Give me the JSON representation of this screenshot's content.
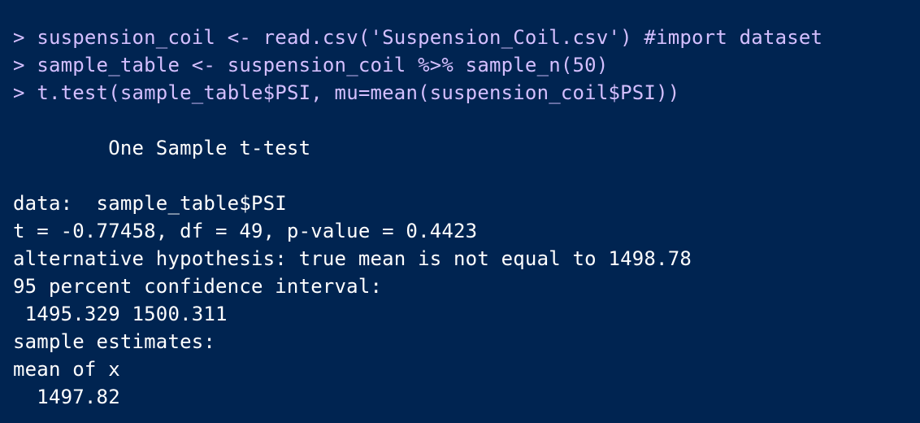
{
  "colors": {
    "background": "#002451",
    "command_text": "#d4bfff",
    "output_text": "#ffffff"
  },
  "console": {
    "prompt": "> ",
    "commands": [
      "suspension_coil <- read.csv('Suspension_Coil.csv') #import dataset",
      "sample_table <- suspension_coil %>% sample_n(50)",
      "t.test(sample_table$PSI, mu=mean(suspension_coil$PSI))"
    ],
    "output": {
      "title": "        One Sample t-test",
      "data_line": "data:  sample_table$PSI",
      "stats_line": "t = -0.77458, df = 49, p-value = 0.4423",
      "alternative_line": "alternative hypothesis: true mean is not equal to 1498.78",
      "ci_label": "95 percent confidence interval:",
      "ci_values": " 1495.329 1500.311",
      "estimates_label": "sample estimates:",
      "estimates_header": "mean of x",
      "estimates_value": "  1497.82"
    }
  }
}
